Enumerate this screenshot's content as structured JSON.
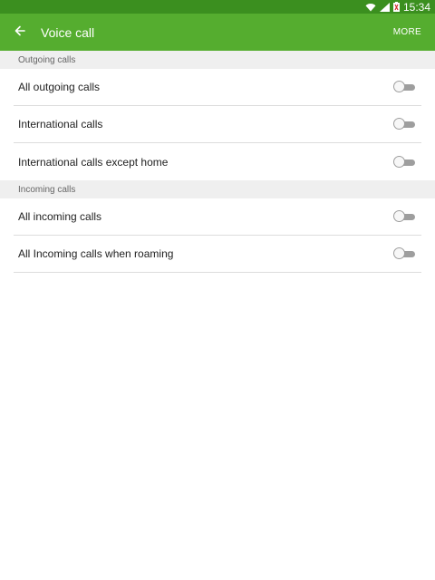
{
  "status_bar": {
    "time": "15:34",
    "icons": [
      "wifi-icon",
      "signal-icon",
      "battery-icon"
    ]
  },
  "app_bar": {
    "title": "Voice call",
    "back_icon": "arrow-left-icon",
    "more_label": "MORE"
  },
  "sections": [
    {
      "header": "Outgoing calls",
      "items": [
        {
          "label": "All outgoing calls",
          "enabled": false
        },
        {
          "label": "International calls",
          "enabled": false
        },
        {
          "label": "International calls except home",
          "enabled": false
        }
      ]
    },
    {
      "header": "Incoming calls",
      "items": [
        {
          "label": "All incoming calls",
          "enabled": false
        },
        {
          "label": "All Incoming calls when roaming",
          "enabled": false
        }
      ]
    }
  ],
  "colors": {
    "status_bar": "#3b8f1f",
    "app_bar": "#55ad2f",
    "section_bg": "#efefef",
    "divider": "#dcdcdc"
  }
}
